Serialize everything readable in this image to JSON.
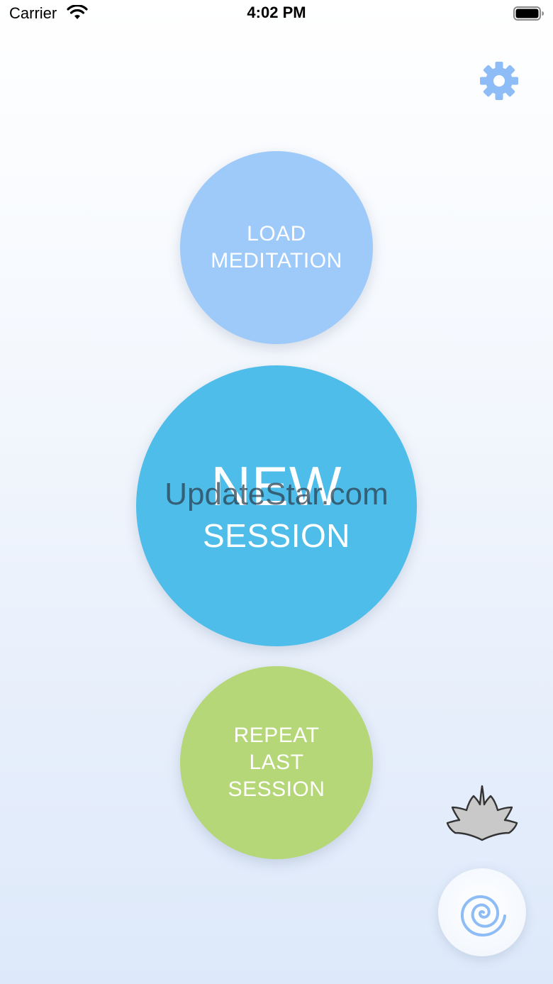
{
  "status_bar": {
    "carrier": "Carrier",
    "time": "4:02 PM"
  },
  "icons": {
    "settings": "gear-icon",
    "wifi": "wifi-icon",
    "battery": "battery-icon",
    "lotus": "lotus-icon",
    "spiral": "spiral-icon"
  },
  "buttons": {
    "load_line1": "LOAD",
    "load_line2": "MEDITATION",
    "new_line1": "NEW",
    "new_line2": "SESSION",
    "repeat_line1": "REPEAT",
    "repeat_line2": "LAST",
    "repeat_line3": "SESSION"
  },
  "watermark": "UpdateStar.com",
  "colors": {
    "load": "#9ecafa",
    "new": "#4fbde9",
    "repeat": "#b5d777",
    "accent": "#8dbcf7"
  }
}
